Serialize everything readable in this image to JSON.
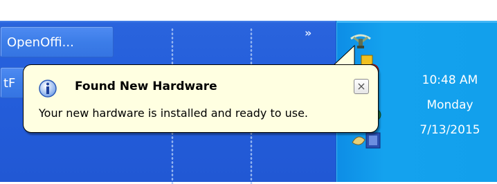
{
  "taskbar": {
    "buttons": [
      {
        "label": "OpenOffi..."
      },
      {
        "label": "tF"
      }
    ],
    "chevron_label": "»"
  },
  "tray": {
    "time": "10:48 AM",
    "day": "Monday",
    "date": "7/13/2015",
    "icons": [
      "network-icon",
      "alert-icon",
      "security-shield-icon",
      "media-icon",
      "display-icon"
    ]
  },
  "balloon": {
    "title": "Found New Hardware",
    "message": "Your new hardware is installed and ready to use.",
    "close_label": "×",
    "icon": "info-icon"
  },
  "colors": {
    "taskbar_blue": "#245edb",
    "tray_blue": "#12a0ec",
    "balloon_bg": "#ffffe1"
  }
}
